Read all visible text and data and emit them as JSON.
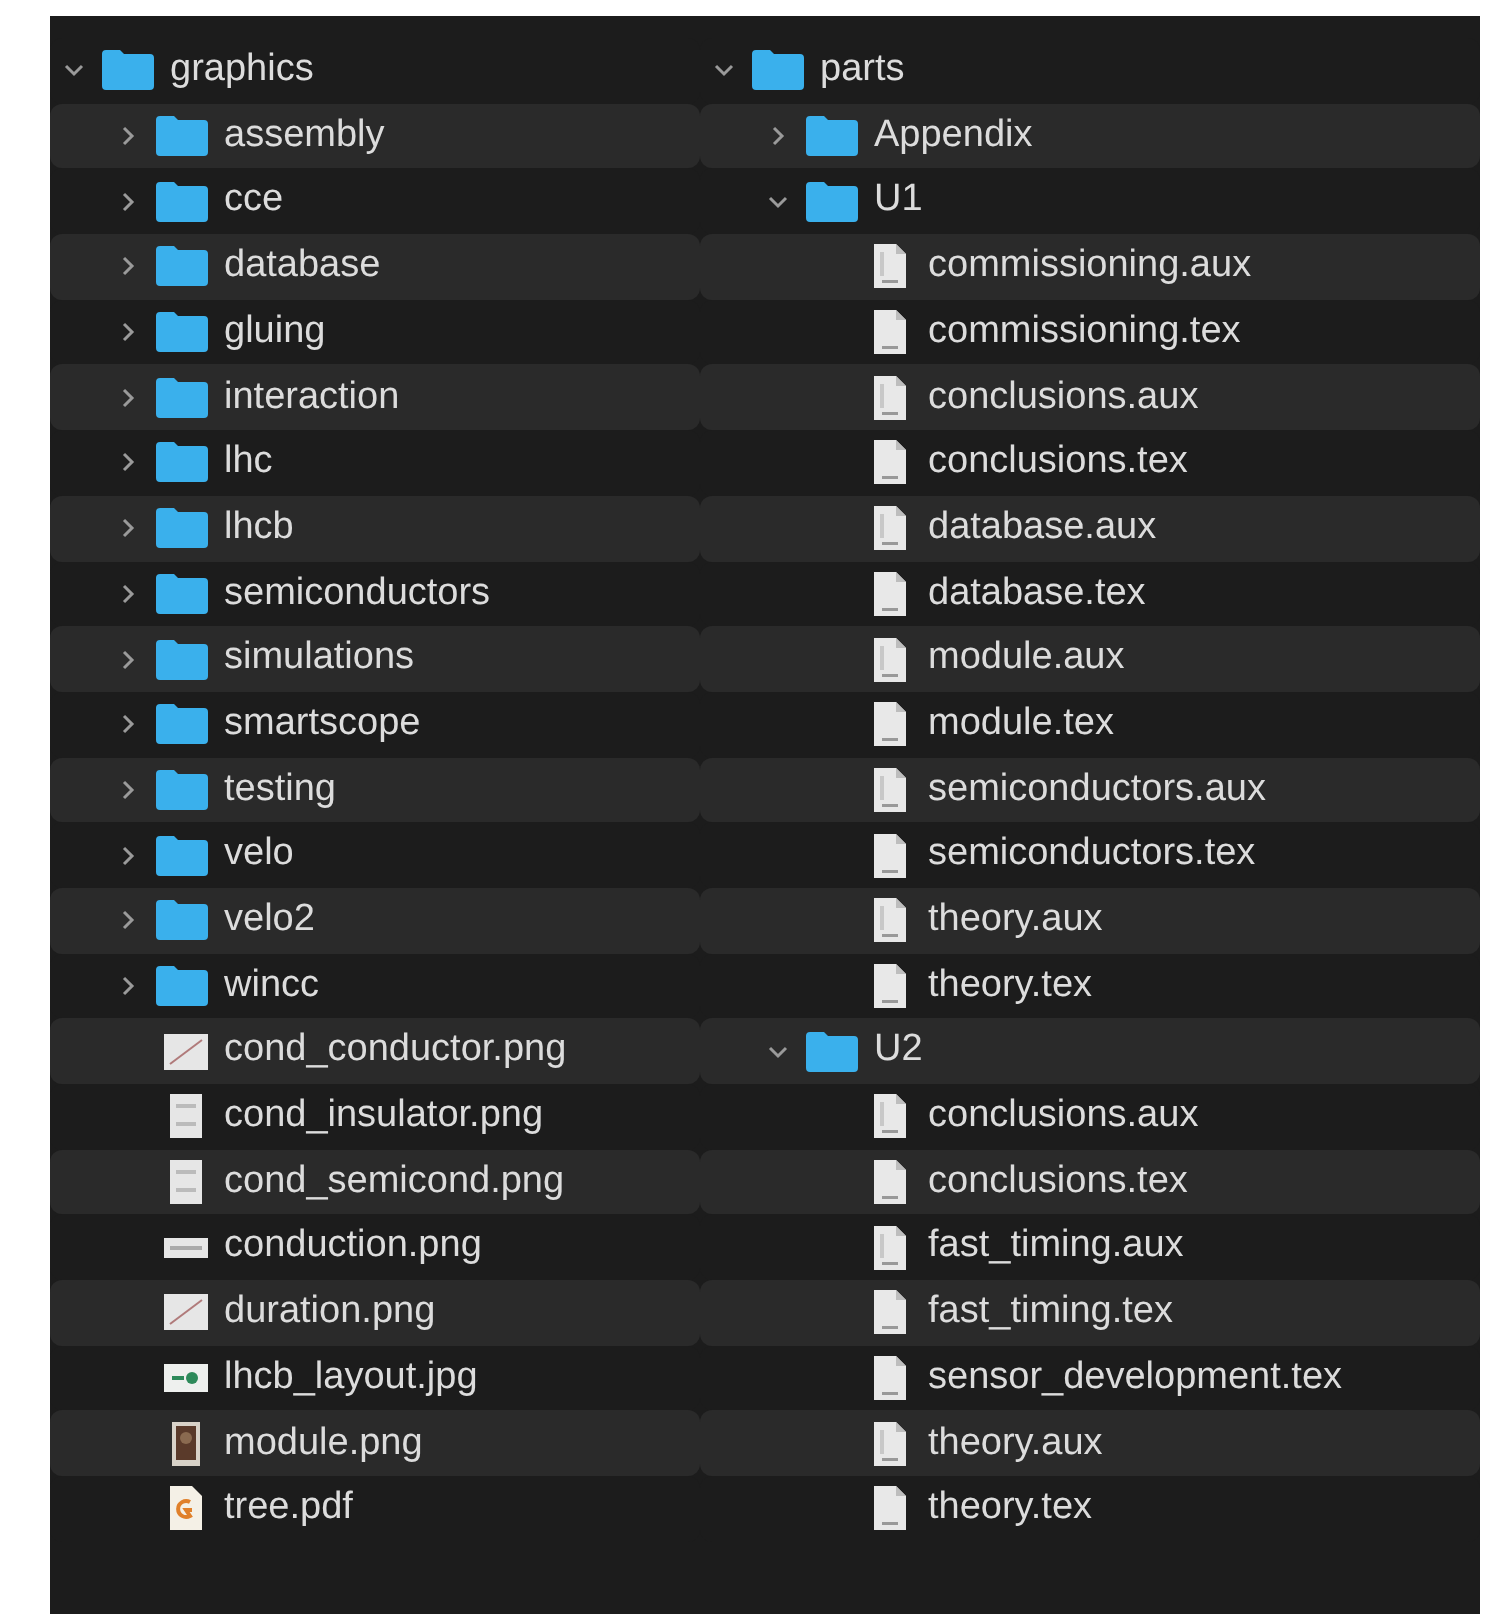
{
  "columns": [
    {
      "tree": [
        {
          "name": "graphics",
          "kind": "folder",
          "expanded": true,
          "children": [
            {
              "name": "assembly",
              "kind": "folder",
              "expanded": false
            },
            {
              "name": "cce",
              "kind": "folder",
              "expanded": false
            },
            {
              "name": "database",
              "kind": "folder",
              "expanded": false
            },
            {
              "name": "gluing",
              "kind": "folder",
              "expanded": false
            },
            {
              "name": "interaction",
              "kind": "folder",
              "expanded": false
            },
            {
              "name": "lhc",
              "kind": "folder",
              "expanded": false
            },
            {
              "name": "lhcb",
              "kind": "folder",
              "expanded": false
            },
            {
              "name": "semiconductors",
              "kind": "folder",
              "expanded": false
            },
            {
              "name": "simulations",
              "kind": "folder",
              "expanded": false
            },
            {
              "name": "smartscope",
              "kind": "folder",
              "expanded": false
            },
            {
              "name": "testing",
              "kind": "folder",
              "expanded": false
            },
            {
              "name": "velo",
              "kind": "folder",
              "expanded": false
            },
            {
              "name": "velo2",
              "kind": "folder",
              "expanded": false
            },
            {
              "name": "wincc",
              "kind": "folder",
              "expanded": false
            },
            {
              "name": "cond_conductor.png",
              "kind": "plot"
            },
            {
              "name": "cond_insulator.png",
              "kind": "image"
            },
            {
              "name": "cond_semicond.png",
              "kind": "image"
            },
            {
              "name": "conduction.png",
              "kind": "strip"
            },
            {
              "name": "duration.png",
              "kind": "plot"
            },
            {
              "name": "lhcb_layout.jpg",
              "kind": "layout"
            },
            {
              "name": "module.png",
              "kind": "photo"
            },
            {
              "name": "tree.pdf",
              "kind": "pdf"
            }
          ]
        }
      ]
    },
    {
      "tree": [
        {
          "name": "parts",
          "kind": "folder",
          "expanded": true,
          "children": [
            {
              "name": "Appendix",
              "kind": "folder",
              "expanded": false
            },
            {
              "name": "U1",
              "kind": "folder",
              "expanded": true,
              "children": [
                {
                  "name": "commissioning.aux",
                  "kind": "aux"
                },
                {
                  "name": "commissioning.tex",
                  "kind": "tex"
                },
                {
                  "name": "conclusions.aux",
                  "kind": "aux"
                },
                {
                  "name": "conclusions.tex",
                  "kind": "tex"
                },
                {
                  "name": "database.aux",
                  "kind": "aux"
                },
                {
                  "name": "database.tex",
                  "kind": "tex"
                },
                {
                  "name": "module.aux",
                  "kind": "aux"
                },
                {
                  "name": "module.tex",
                  "kind": "tex"
                },
                {
                  "name": "semiconductors.aux",
                  "kind": "aux"
                },
                {
                  "name": "semiconductors.tex",
                  "kind": "tex"
                },
                {
                  "name": "theory.aux",
                  "kind": "aux"
                },
                {
                  "name": "theory.tex",
                  "kind": "tex"
                }
              ]
            },
            {
              "name": "U2",
              "kind": "folder",
              "expanded": true,
              "children": [
                {
                  "name": "conclusions.aux",
                  "kind": "aux"
                },
                {
                  "name": "conclusions.tex",
                  "kind": "tex"
                },
                {
                  "name": "fast_timing.aux",
                  "kind": "aux"
                },
                {
                  "name": "fast_timing.tex",
                  "kind": "tex"
                },
                {
                  "name": "sensor_development.tex",
                  "kind": "tex"
                },
                {
                  "name": "theory.aux",
                  "kind": "aux"
                },
                {
                  "name": "theory.tex",
                  "kind": "tex"
                }
              ]
            }
          ]
        }
      ]
    }
  ]
}
